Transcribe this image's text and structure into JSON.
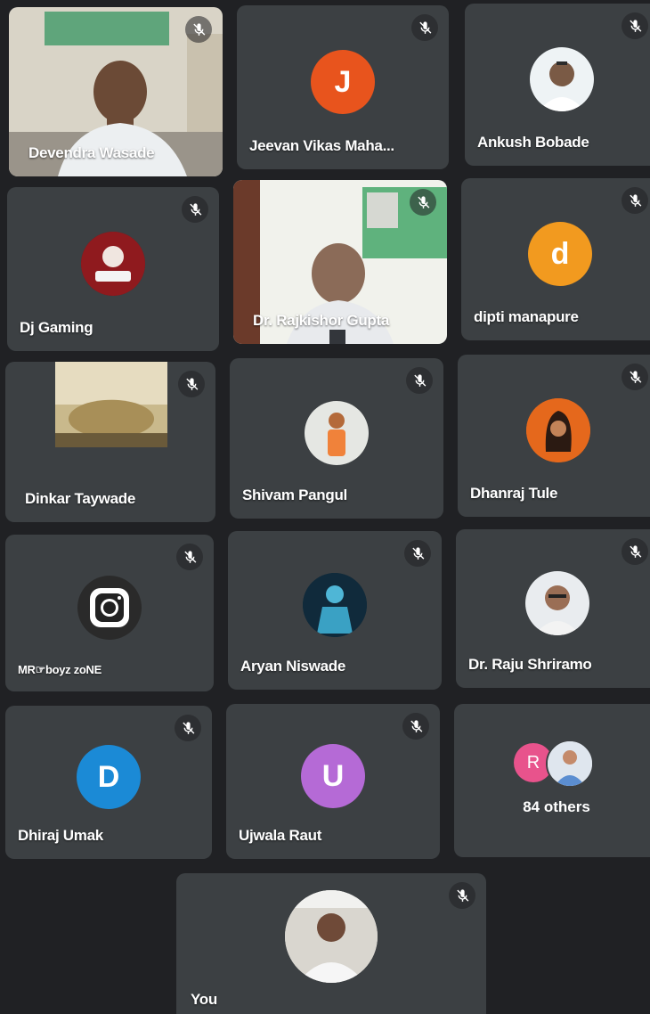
{
  "participants": [
    {
      "name": "Devendra Wasade",
      "muted": true,
      "kind": "video"
    },
    {
      "name": "Jeevan Vikas Maha...",
      "muted": true,
      "kind": "letter",
      "initial": "J",
      "color": "#e8541d"
    },
    {
      "name": "Ankush Bobade",
      "muted": true,
      "kind": "photo"
    },
    {
      "name": "Dj Gaming",
      "muted": true,
      "kind": "photo"
    },
    {
      "name": "Dr. Rajkishor Gupta",
      "muted": true,
      "kind": "video"
    },
    {
      "name": "dipti manapure",
      "muted": true,
      "kind": "letter",
      "initial": "d",
      "color": "#f29a1f"
    },
    {
      "name": "Dinkar Taywade",
      "muted": true,
      "kind": "video"
    },
    {
      "name": "Shivam Pangul",
      "muted": true,
      "kind": "photo"
    },
    {
      "name": "Dhanraj Tule",
      "muted": true,
      "kind": "photo"
    },
    {
      "name": "MR☞boyz zoNE",
      "muted": true,
      "kind": "photo"
    },
    {
      "name": "Aryan Niswade",
      "muted": true,
      "kind": "photo"
    },
    {
      "name": "Dr. Raju Shriramo",
      "muted": true,
      "kind": "photo"
    },
    {
      "name": "Dhiraj Umak",
      "muted": true,
      "kind": "letter",
      "initial": "D",
      "color": "#1b8ad6"
    },
    {
      "name": "Ujwala Raut",
      "muted": true,
      "kind": "letter",
      "initial": "U",
      "color": "#b56ad6"
    }
  ],
  "others": {
    "label": "84 others",
    "initial": "R",
    "color": "#e8538c"
  },
  "self": {
    "name": "You",
    "muted": true
  },
  "icons": {
    "mute": "mic-off-icon"
  }
}
